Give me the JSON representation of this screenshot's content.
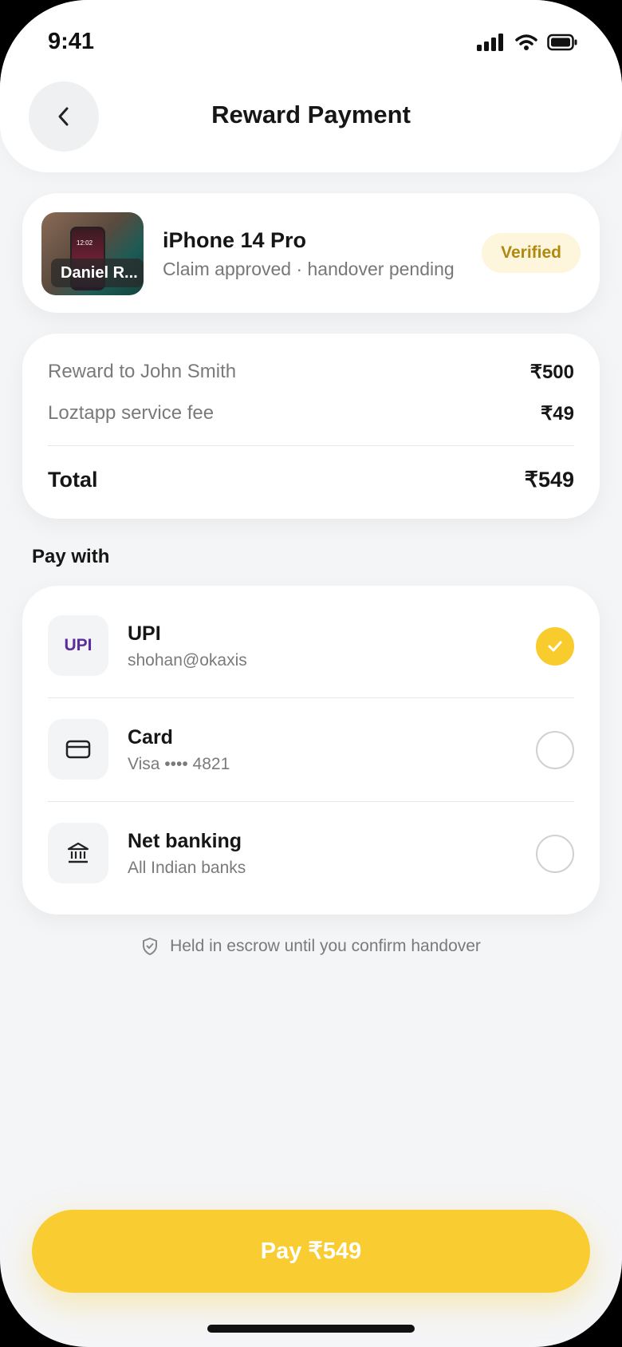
{
  "status_bar": {
    "time": "9:41"
  },
  "header": {
    "title": "Reward Payment"
  },
  "item": {
    "thumb_tag": "Daniel R...",
    "thumb_phone_time": "12:02",
    "title": "iPhone 14 Pro",
    "subtitle": "Claim approved · handover pending",
    "badge": "Verified"
  },
  "summary": {
    "rows": [
      {
        "label": "Reward to John Smith",
        "value": "₹500"
      },
      {
        "label": "Loztapp service fee",
        "value": "₹49"
      }
    ],
    "total_label": "Total",
    "total_value": "₹549"
  },
  "pay_with": {
    "label": "Pay with",
    "methods": [
      {
        "icon_text": "UPI",
        "title": "UPI",
        "subtitle": "shohan@okaxis",
        "selected": true
      },
      {
        "title": "Card",
        "subtitle": "Visa •••• 4821",
        "selected": false
      },
      {
        "title": "Net banking",
        "subtitle": "All Indian banks",
        "selected": false
      }
    ]
  },
  "escrow_note": "Held in escrow until you confirm handover",
  "pay_button": "Pay ₹549",
  "colors": {
    "accent": "#f9cd31",
    "upi": "#5b2ba0",
    "badge_text": "#b08a10",
    "badge_bg": "#fdf6dc"
  }
}
